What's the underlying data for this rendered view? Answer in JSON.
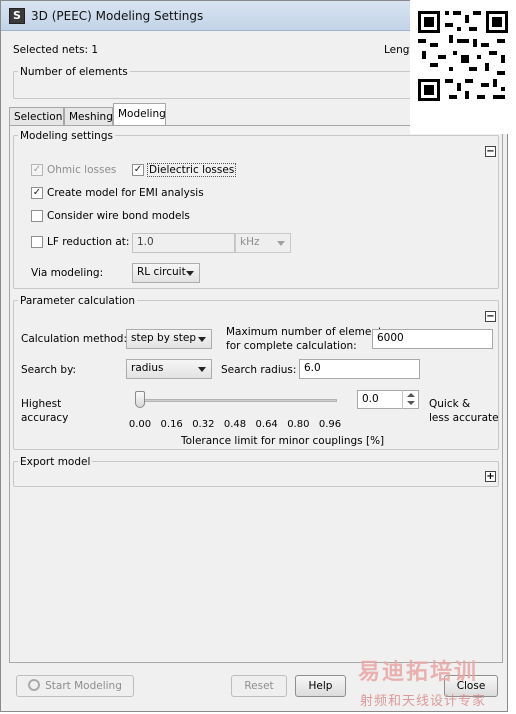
{
  "window": {
    "title": "3D (PEEC) Modeling Settings",
    "icon": "app-icon",
    "icon_glyph": "S"
  },
  "header": {
    "selected_nets": "Selected nets: 1",
    "length_label": "Lengt",
    "number_of_elements_label": "Number of elements"
  },
  "tabs": [
    {
      "label": "Selection",
      "active": false
    },
    {
      "label": "Meshing",
      "active": false
    },
    {
      "label": "Modeling",
      "active": true
    }
  ],
  "modeling_settings": {
    "title": "Modeling settings",
    "ohmic_losses": {
      "label": "Ohmic losses",
      "checked": true,
      "enabled": false
    },
    "dielectric_losses": {
      "label": "Dielectric losses",
      "checked": true,
      "enabled": true
    },
    "emi_model": {
      "label": "Create model for EMI analysis",
      "checked": true
    },
    "wire_bond": {
      "label": "Consider wire bond models",
      "checked": false
    },
    "lf_reduction": {
      "label": "LF reduction at:",
      "checked": false,
      "value": "1.0",
      "unit": "kHz"
    },
    "via_modeling": {
      "label": "Via modeling:",
      "value": "RL circuit"
    }
  },
  "parameter_calculation": {
    "title": "Parameter calculation",
    "calculation_method": {
      "label": "Calculation method:",
      "value": "step by step"
    },
    "max_elements": {
      "label_line1": "Maximum number of elements",
      "label_line2": "for complete calculation:",
      "value": "6000"
    },
    "search_by": {
      "label": "Search by:",
      "value": "radius"
    },
    "search_radius": {
      "label": "Search radius:",
      "value": "6.0"
    },
    "accuracy_left_line1": "Highest",
    "accuracy_left_line2": "accuracy",
    "accuracy_right_line1": "Quick &",
    "accuracy_right_line2": "less accurate",
    "tolerance_value": "0.0",
    "slider_ticks": [
      "0.00",
      "0.16",
      "0.32",
      "0.48",
      "0.64",
      "0.80",
      "0.96"
    ],
    "slider_level": 0.0,
    "slider_caption": "Tolerance limit for minor couplings [%]"
  },
  "export_model": {
    "title": "Export model"
  },
  "footer": {
    "start_modeling": "Start Modeling",
    "reset": "Reset",
    "help": "Help",
    "close": "Close"
  },
  "watermark": {
    "line1": "易迪拓培训",
    "line2": "射频和天线设计专家"
  },
  "colors": {
    "window_bg": "#f0f0f0",
    "titlebar": "#c2d3e8",
    "disabled_text": "#8d8d8d"
  }
}
